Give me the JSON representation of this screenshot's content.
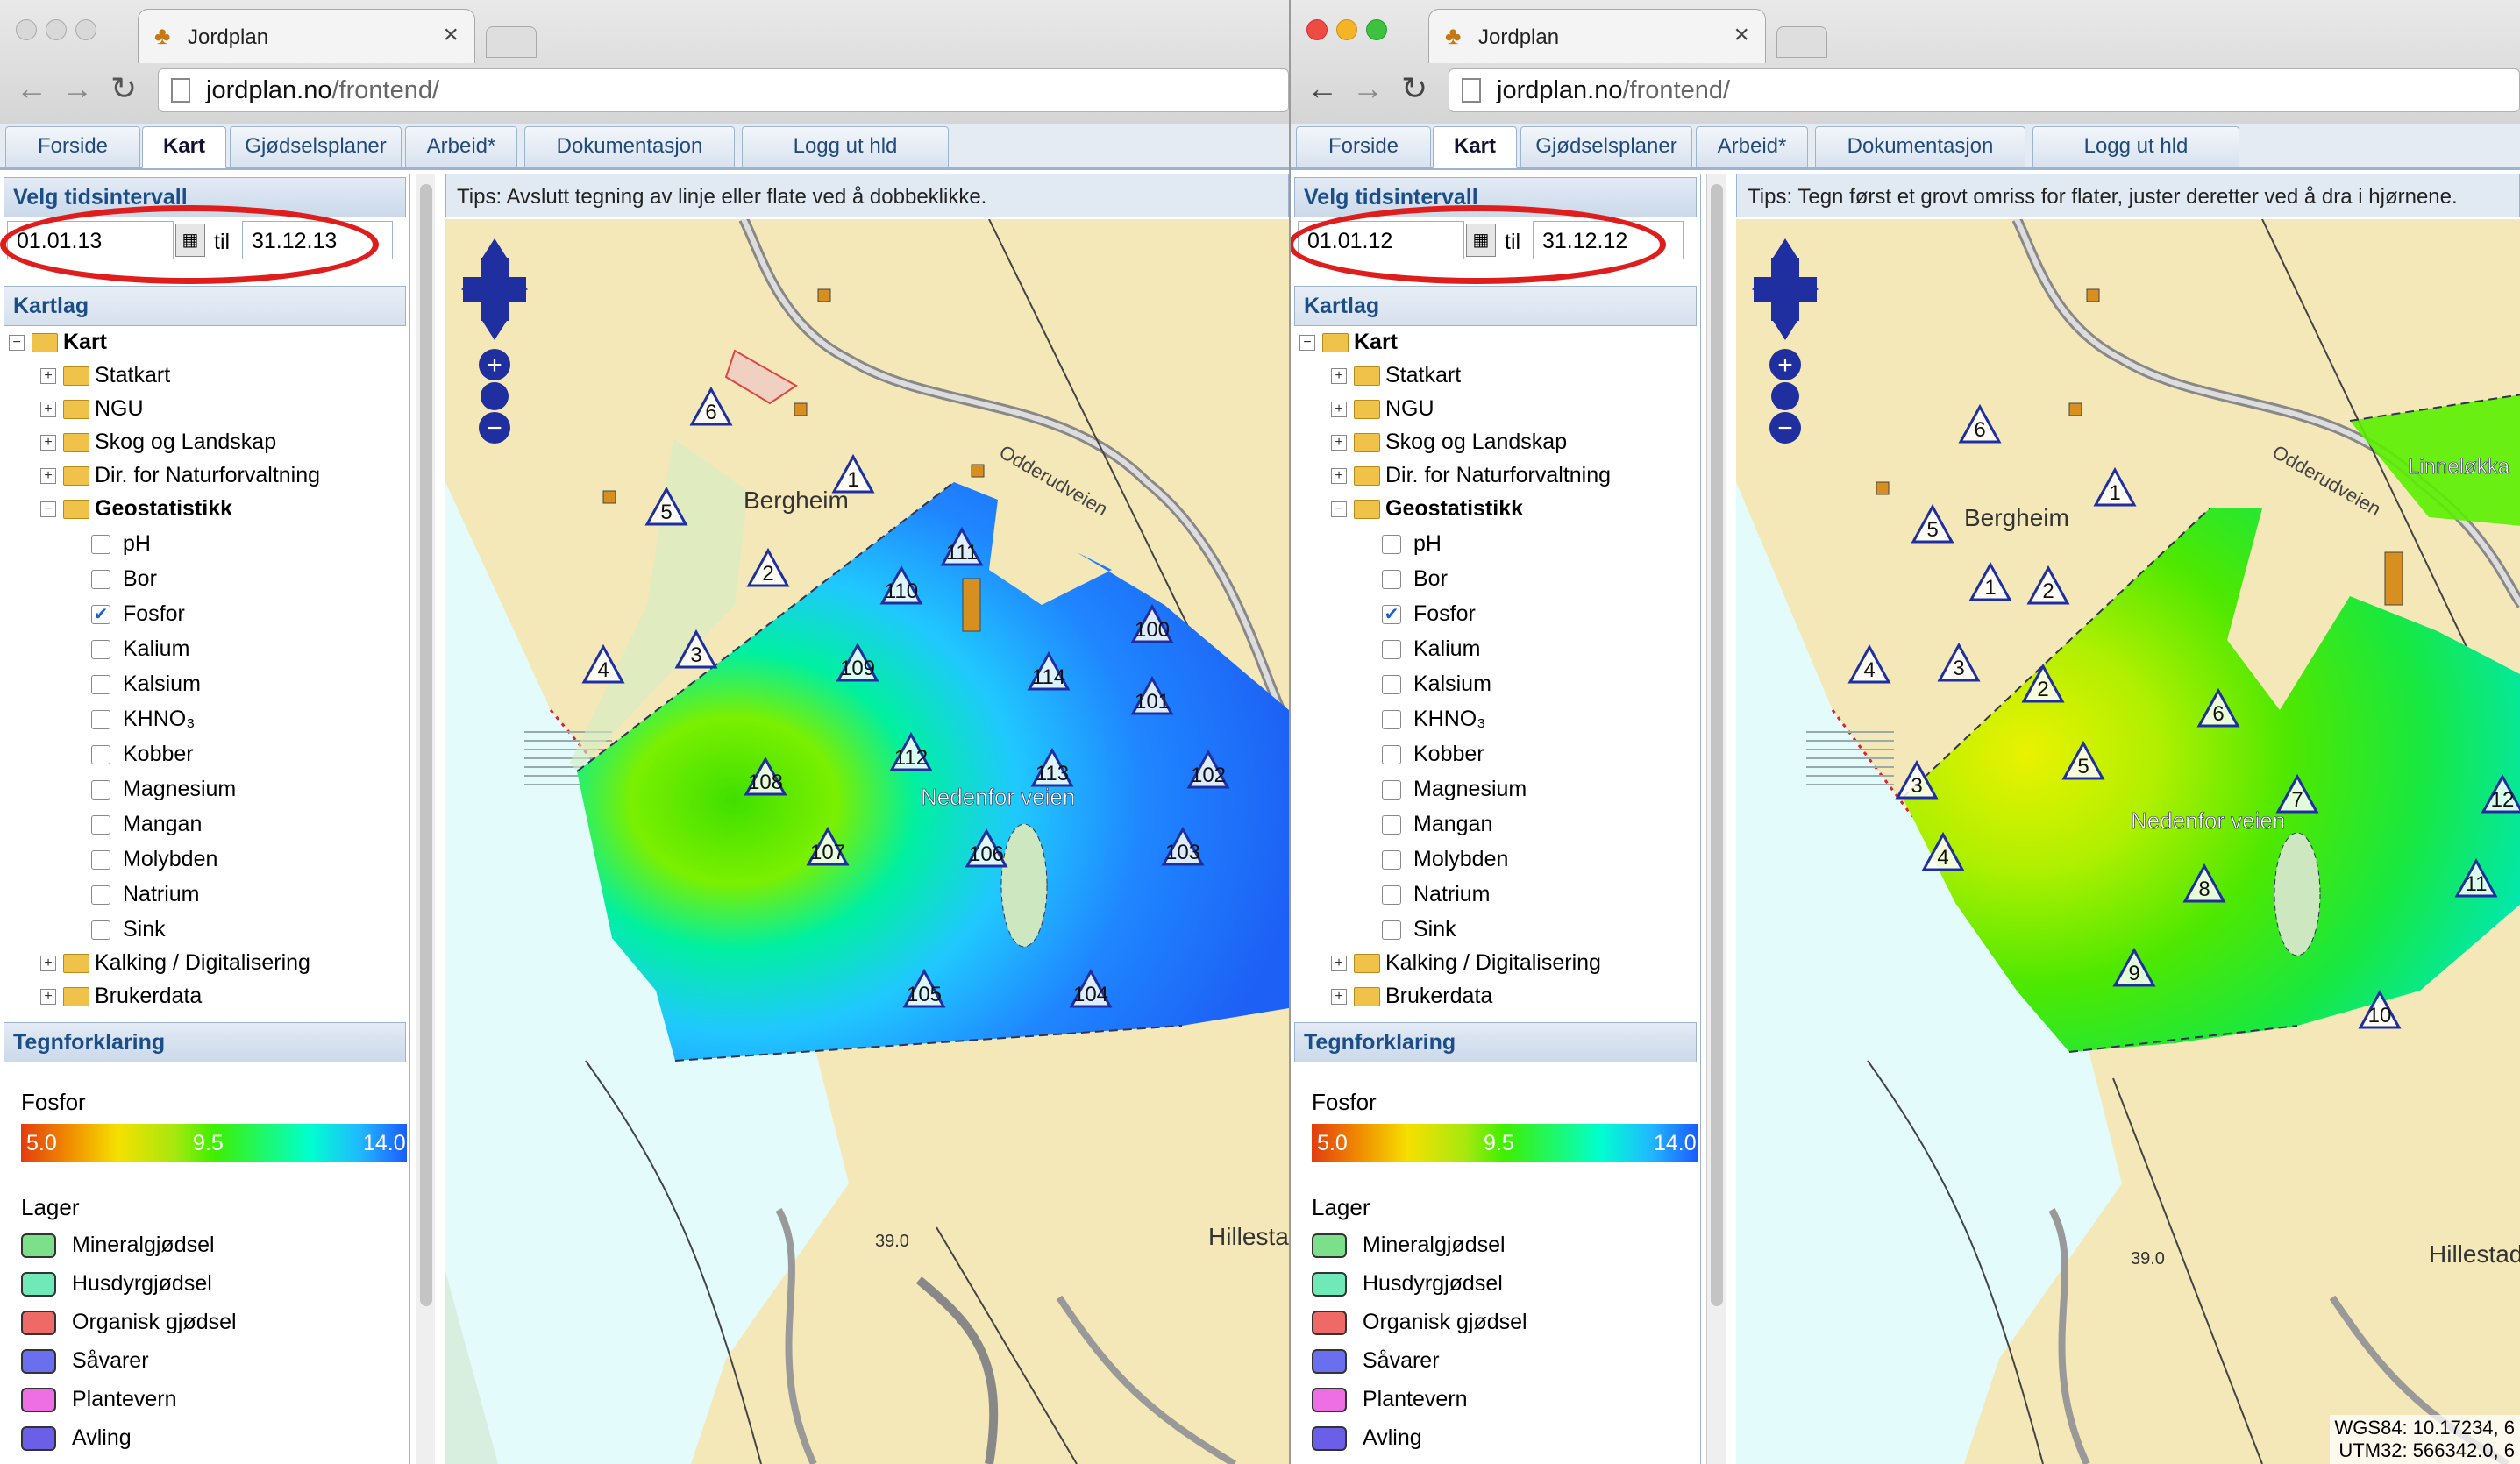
{
  "browser": {
    "tab_title": "Jordplan",
    "url_domain": "jordplan.no",
    "url_path": "/frontend/"
  },
  "nav_tabs": [
    "Forside",
    "Kart",
    "Gjødselsplaner",
    "Arbeid*",
    "Dokumentasjon",
    "Logg ut hld"
  ],
  "sidebar": {
    "interval_header": "Velg tidsintervall",
    "til_label": "til",
    "layers_header": "Kartlag",
    "tree": {
      "root": "Kart",
      "groups": [
        "Statkart",
        "NGU",
        "Skog og Landskap",
        "Dir. for Naturforvaltning",
        "Geostatistikk"
      ],
      "geostat_items": [
        "pH",
        "Bor",
        "Fosfor",
        "Kalium",
        "Kalsium",
        "KHNO₃",
        "Kobber",
        "Magnesium",
        "Mangan",
        "Molybden",
        "Natrium",
        "Sink"
      ],
      "checked_item": "Fosfor",
      "after_groups": [
        "Kalking / Digitalisering",
        "Brukerdata"
      ]
    },
    "legend_header": "Tegnforklaring",
    "legend_title": "Fosfor",
    "ramp_labels": [
      "5.0",
      "9.5",
      "14.0"
    ],
    "layers_title": "Lager",
    "layers": [
      {
        "label": "Mineralgjødsel",
        "color": "#7ce08a"
      },
      {
        "label": "Husdyrgjødsel",
        "color": "#6fe9b7"
      },
      {
        "label": "Organisk gjødsel",
        "color": "#ef6a66"
      },
      {
        "label": "Såvarer",
        "color": "#6a6ff0"
      },
      {
        "label": "Plantevern",
        "color": "#ee6fe3"
      },
      {
        "label": "Avling",
        "color": "#6a5fe6"
      }
    ]
  },
  "left": {
    "date_from": "01.01.13",
    "date_to": "31.12.13",
    "tips": "Tips: Avslutt tegning av linje eller flate ved å dobbeklikke.",
    "map": {
      "place_bergheim": "Bergheim",
      "road_label": "Odderudveien",
      "field_label": "Nedenfor veien",
      "hillestad": "Hillestad",
      "elevation": "39.0",
      "markers_outside": [
        "1",
        "2",
        "3",
        "4",
        "5",
        "6"
      ],
      "markers_field": [
        "100",
        "101",
        "102",
        "103",
        "104",
        "105",
        "106",
        "107",
        "108",
        "109",
        "110",
        "111",
        "112",
        "113",
        "114"
      ]
    }
  },
  "right": {
    "date_from": "01.01.12",
    "date_to": "31.12.12",
    "tips": "Tips: Tegn først et grovt omriss for flater, juster deretter ved å dra i hjørnene.",
    "map": {
      "place_bergheim": "Bergheim",
      "road_label": "Odderudveien",
      "field_label": "Nedenfor veien",
      "field2_label": "Linneløkka",
      "hillestad": "Hillestad",
      "elevation": "39.0",
      "markers_outside": [
        "1",
        "2",
        "3",
        "4",
        "5",
        "6"
      ],
      "markers_field": [
        "1",
        "2",
        "3",
        "4",
        "5",
        "6",
        "7",
        "8",
        "9",
        "10",
        "11",
        "12"
      ],
      "coords_line1": "WGS84: 10.17234, 6",
      "coords_line2": "UTM32: 566342.0, 6"
    }
  },
  "colors": {
    "accent": "#1b4e87",
    "highlight_oval": "#e01d1d",
    "map_base": "#f5e8b8",
    "water": "#e3fbfb"
  }
}
